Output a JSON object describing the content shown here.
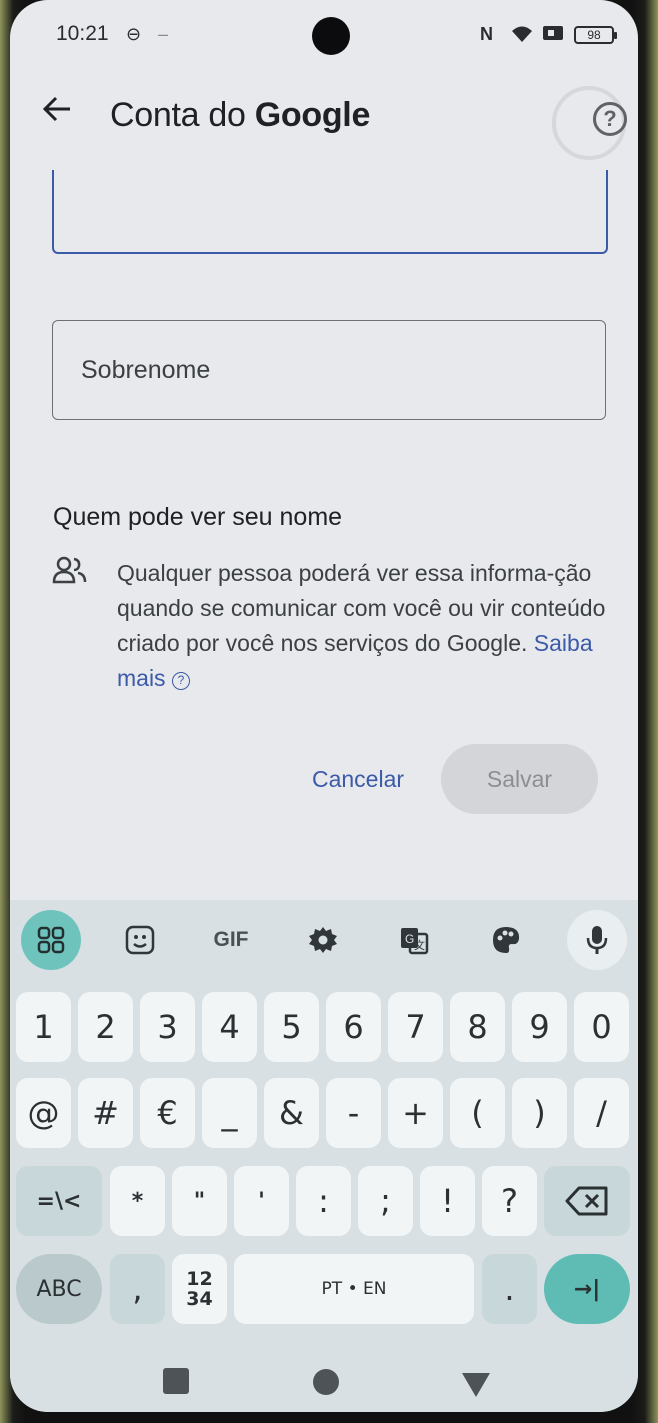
{
  "status_bar": {
    "time": "10:21",
    "battery": "98"
  },
  "app_bar": {
    "title_prefix": "Conta do ",
    "title_brand": "Google"
  },
  "form": {
    "surname_placeholder": "Sobrenome"
  },
  "visibility": {
    "heading": "Quem pode ver seu nome",
    "info_text": "Qualquer pessoa poderá ver essa informa-ção quando se comunicar com você ou vir conteúdo criado por você nos serviços do Google. ",
    "learn_more": "Saiba mais"
  },
  "actions": {
    "cancel": "Cancelar",
    "save": "Salvar"
  },
  "keyboard": {
    "toolbar": [
      "apps-grid",
      "sticker",
      "GIF",
      "settings",
      "translate",
      "palette",
      "mic"
    ],
    "gif_label": "GIF",
    "row1": [
      "1",
      "2",
      "3",
      "4",
      "5",
      "6",
      "7",
      "8",
      "9",
      "0"
    ],
    "row2": [
      "@",
      "#",
      "€",
      "_",
      "&",
      "-",
      "+",
      "(",
      ")",
      "/"
    ],
    "row3": [
      "=\\<",
      "*",
      "\"",
      "'",
      ":",
      ";",
      "!",
      "?"
    ],
    "abc": "ABC",
    "comma": ",",
    "num_top": "12",
    "num_bottom": "34",
    "space": "PT • EN",
    "period": ".",
    "enter_glyph": "→|"
  },
  "colors": {
    "accent_blue": "#3b5aa8",
    "keyboard_teal": "#5fbcb5"
  }
}
